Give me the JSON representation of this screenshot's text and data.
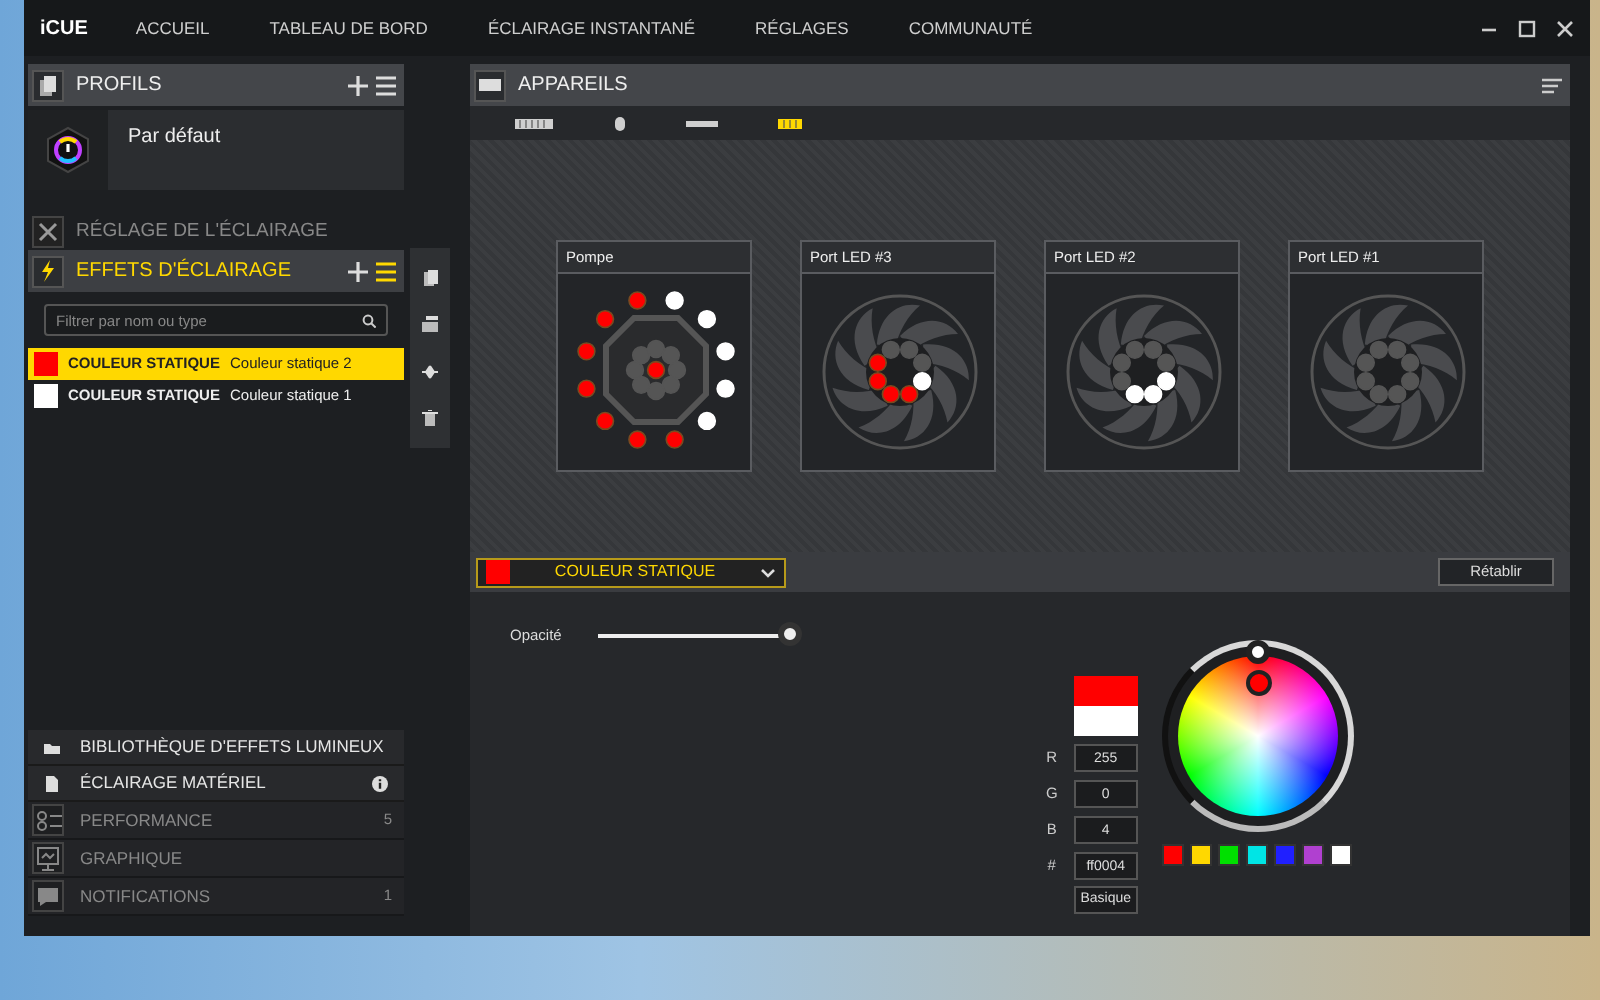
{
  "window": {
    "title": "iCUE"
  },
  "nav": [
    {
      "label": "ACCUEIL",
      "selected": false
    },
    {
      "label": "TABLEAU DE BORD",
      "selected": false
    },
    {
      "label": "ÉCLAIRAGE INSTANTANÉ",
      "selected": false
    },
    {
      "label": "RÉGLAGES",
      "selected": false
    },
    {
      "label": "COMMUNAUTÉ",
      "selected": false
    }
  ],
  "profiles": {
    "title": "PROFILS",
    "items": [
      {
        "name": "Par défaut"
      }
    ]
  },
  "lighting_setup": {
    "title": "RÉGLAGE DE L'ÉCLAIRAGE"
  },
  "lighting_effects": {
    "title": "EFFETS D'ÉCLAIRAGE",
    "filter": {
      "placeholder": "Filtrer par nom ou type"
    },
    "items": [
      {
        "type": "COULEUR STATIQUE",
        "name": "Couleur statique 2",
        "color": "#ff0000",
        "selected": true
      },
      {
        "type": "COULEUR STATIQUE",
        "name": "Couleur statique 1",
        "color": "#ffffff",
        "selected": false
      }
    ]
  },
  "lighting_subsections": [
    {
      "kind": "library",
      "label": "BIBLIOTHÈQUE D'EFFETS LUMINEUX"
    },
    {
      "kind": "hardware",
      "label": "ÉCLAIRAGE MATÉRIEL"
    }
  ],
  "modules": [
    {
      "kind": "performance",
      "label": "PERFORMANCE",
      "count": "5"
    },
    {
      "kind": "graphics",
      "label": "GRAPHIQUE"
    },
    {
      "kind": "notifications",
      "label": "NOTIFICATIONS",
      "count": "1"
    }
  ],
  "devices": {
    "title": "APPAREILS",
    "tabs": [
      {
        "kind": "keyboard",
        "selected": false
      },
      {
        "kind": "mouse",
        "selected": false
      },
      {
        "kind": "strip",
        "selected": false
      },
      {
        "kind": "cooler",
        "selected": true
      }
    ],
    "zones": [
      {
        "name": "Pompe",
        "kind": "pump",
        "outer_leds": [
          {
            "color": "#ff0000"
          },
          {
            "color": "#ffffff"
          },
          {
            "color": "#ffffff"
          },
          {
            "color": "#ffffff"
          },
          {
            "color": "#ffffff"
          },
          {
            "color": "#ffffff"
          },
          {
            "color": "#ff0000"
          },
          {
            "color": "#ff0000"
          },
          {
            "color": "#ff0000"
          },
          {
            "color": "#ff0000"
          },
          {
            "color": "#ff0000"
          },
          {
            "color": "#ff0000"
          }
        ],
        "inner_leds": [
          {
            "color": "#555555"
          },
          {
            "color": "#555555"
          },
          {
            "color": "#555555"
          },
          {
            "color": "#555555"
          },
          {
            "color": "#555555"
          },
          {
            "color": "#555555"
          },
          {
            "color": "#555555"
          },
          {
            "color": "#555555"
          }
        ],
        "center_led": {
          "color": "#ff0000"
        }
      },
      {
        "name": "Port LED #3",
        "kind": "fan",
        "leds": [
          {
            "color": "#555555"
          },
          {
            "color": "#555555"
          },
          {
            "color": "#555555"
          },
          {
            "color": "#ffffff"
          },
          {
            "color": "#ff0000"
          },
          {
            "color": "#ff0000"
          },
          {
            "color": "#ff0000"
          },
          {
            "color": "#ff0000"
          }
        ]
      },
      {
        "name": "Port LED #2",
        "kind": "fan",
        "leds": [
          {
            "color": "#555555"
          },
          {
            "color": "#555555"
          },
          {
            "color": "#555555"
          },
          {
            "color": "#ffffff"
          },
          {
            "color": "#ffffff"
          },
          {
            "color": "#ffffff"
          },
          {
            "color": "#555555"
          },
          {
            "color": "#555555"
          }
        ]
      },
      {
        "name": "Port LED #1",
        "kind": "fan",
        "leds": [
          {
            "color": "#555555"
          },
          {
            "color": "#555555"
          },
          {
            "color": "#555555"
          },
          {
            "color": "#555555"
          },
          {
            "color": "#555555"
          },
          {
            "color": "#555555"
          },
          {
            "color": "#555555"
          },
          {
            "color": "#555555"
          }
        ]
      }
    ]
  },
  "effect_editor": {
    "effect": {
      "label": "COULEUR STATIQUE",
      "color": "#ff0000"
    },
    "reset_button": "Rétablir",
    "opacity": {
      "label": "Opacité",
      "level": 1
    },
    "color": {
      "new_swatch": {
        "color": "#ff0000"
      },
      "old_swatch": {
        "color": "#ffffff"
      },
      "fields": [
        {
          "label": "R",
          "value": "255"
        },
        {
          "label": "G",
          "value": "0"
        },
        {
          "label": "B",
          "value": "4"
        },
        {
          "label": "#",
          "value": "ff0004"
        }
      ],
      "basic_button": "Basique",
      "swatches": [
        {
          "color": "#ff0000"
        },
        {
          "color": "#ffd800"
        },
        {
          "color": "#00e000"
        },
        {
          "color": "#00e5e5"
        },
        {
          "color": "#2020ff"
        },
        {
          "color": "#b040d0"
        },
        {
          "color": "#ffffff"
        }
      ]
    }
  }
}
